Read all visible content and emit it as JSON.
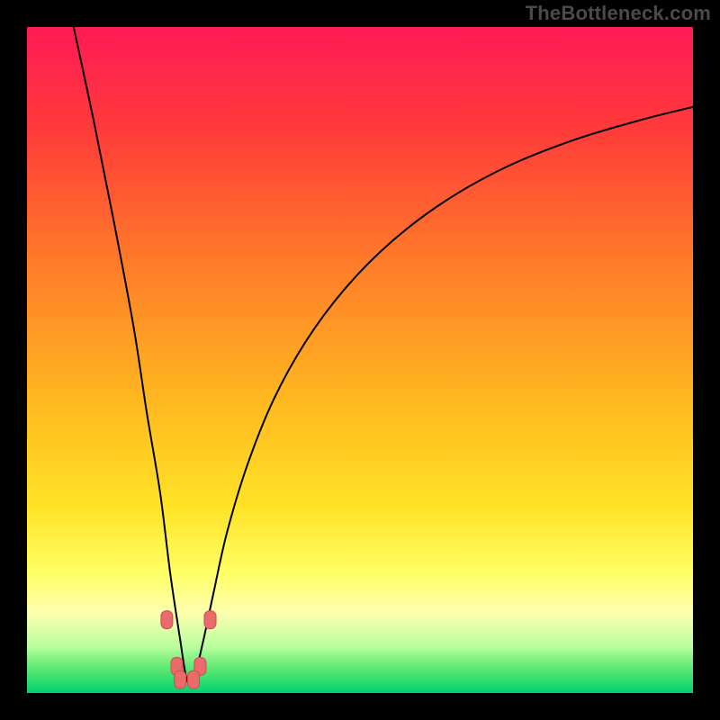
{
  "watermark": "TheBottleneck.com",
  "colors": {
    "page_bg": "#000000",
    "curve_stroke": "#000000",
    "marker_fill": "#ea6b6b",
    "marker_stroke": "#c94f4f",
    "gradient_stops": [
      {
        "offset": 0.0,
        "color": "#ff1a55"
      },
      {
        "offset": 0.15,
        "color": "#ff3a3a"
      },
      {
        "offset": 0.35,
        "color": "#ff7a2a"
      },
      {
        "offset": 0.55,
        "color": "#ffb520"
      },
      {
        "offset": 0.72,
        "color": "#ffe326"
      },
      {
        "offset": 0.82,
        "color": "#ffff66"
      },
      {
        "offset": 0.88,
        "color": "#fdffb0"
      },
      {
        "offset": 0.93,
        "color": "#b8ff9e"
      },
      {
        "offset": 0.965,
        "color": "#58e66f"
      },
      {
        "offset": 1.0,
        "color": "#00d272"
      }
    ]
  },
  "chart_data": {
    "type": "line",
    "title": "",
    "xlabel": "",
    "ylabel": "",
    "xlim": [
      0,
      100
    ],
    "ylim": [
      0,
      100
    ],
    "note": "Bottleneck-style V-curve over a red→green vertical gradient. Minimum (optimal point) near x≈24, y≈2. Left branch rises steeply toward top-left; right branch rises with diminishing slope toward upper-right. Values are estimated from pixel positions relative to the 740×740 plot area.",
    "series": [
      {
        "name": "bottleneck-curve",
        "x": [
          7,
          10,
          13,
          16,
          18,
          20,
          21.5,
          23,
          24,
          25,
          26.5,
          28,
          30,
          33,
          37,
          42,
          48,
          55,
          63,
          72,
          82,
          92,
          100
        ],
        "y": [
          100,
          86,
          71,
          55,
          42,
          30,
          18,
          8,
          2,
          2,
          8,
          15,
          24,
          34,
          44,
          53,
          61,
          68,
          74,
          79,
          83,
          86,
          88
        ]
      }
    ],
    "markers": [
      {
        "x": 21.0,
        "y": 11.0
      },
      {
        "x": 27.5,
        "y": 11.0
      },
      {
        "x": 22.5,
        "y": 4.0
      },
      {
        "x": 26.0,
        "y": 4.0
      },
      {
        "x": 23.0,
        "y": 2.0
      },
      {
        "x": 25.0,
        "y": 2.0
      }
    ]
  }
}
